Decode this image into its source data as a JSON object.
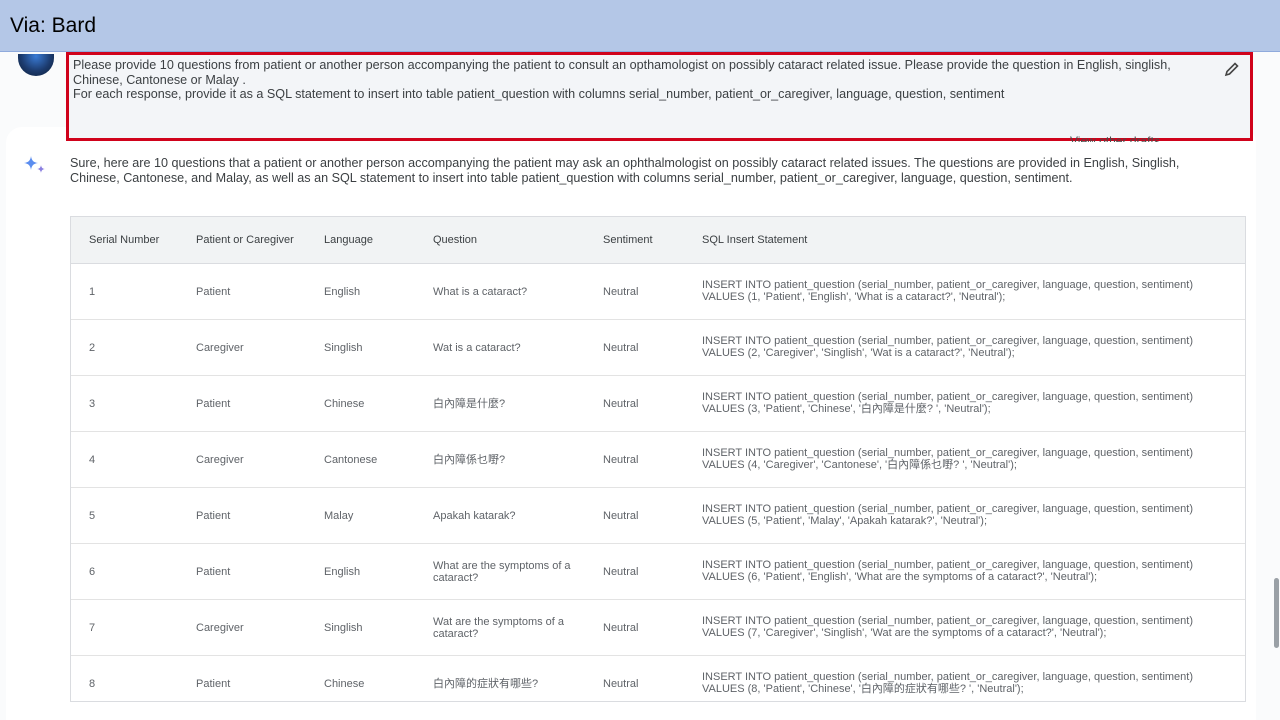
{
  "banner": {
    "text": "Via: Bard"
  },
  "prompt": {
    "text": "Please provide 10 questions from patient or another person accompanying the patient to consult an opthamologist on possibly cataract related issue. Please provide the question in English, singlish, Chinese, Cantonese or Malay .\nFor each response, provide it as a SQL statement to insert into table patient_question with columns serial_number, patient_or_caregiver, language, question, sentiment",
    "drafts_label": "View other drafts"
  },
  "response": {
    "text": "Sure, here are 10 questions that a patient or another person accompanying the patient may ask an ophthalmologist on possibly cataract related issues. The questions are provided in English, Singlish, Chinese, Cantonese, and Malay, as well as an SQL statement to insert into table patient_question with columns serial_number, patient_or_caregiver, language, question, sentiment."
  },
  "table": {
    "headers": [
      "Serial Number",
      "Patient or Caregiver",
      "Language",
      "Question",
      "Sentiment",
      "SQL Insert Statement"
    ],
    "rows": [
      [
        "1",
        "Patient",
        "English",
        "What is a cataract?",
        "Neutral",
        "INSERT INTO patient_question (serial_number, patient_or_caregiver, language, question, sentiment) VALUES (1, 'Patient', 'English', 'What is a cataract?', 'Neutral');"
      ],
      [
        "2",
        "Caregiver",
        "Singlish",
        "Wat is a cataract?",
        "Neutral",
        "INSERT INTO patient_question (serial_number, patient_or_caregiver, language, question, sentiment) VALUES (2, 'Caregiver', 'Singlish', 'Wat is a cataract?', 'Neutral');"
      ],
      [
        "3",
        "Patient",
        "Chinese",
        "白內障是什麼?",
        "Neutral",
        "INSERT INTO patient_question (serial_number, patient_or_caregiver, language, question, sentiment) VALUES (3, 'Patient', 'Chinese', '白內障是什麼? ', 'Neutral');"
      ],
      [
        "4",
        "Caregiver",
        "Cantonese",
        "白內障係乜嘢?",
        "Neutral",
        "INSERT INTO patient_question (serial_number, patient_or_caregiver, language, question, sentiment) VALUES (4, 'Caregiver', 'Cantonese', '白內障係乜嘢? ', 'Neutral');"
      ],
      [
        "5",
        "Patient",
        "Malay",
        "Apakah katarak?",
        "Neutral",
        "INSERT INTO patient_question (serial_number, patient_or_caregiver, language, question, sentiment) VALUES (5, 'Patient', 'Malay', 'Apakah katarak?', 'Neutral');"
      ],
      [
        "6",
        "Patient",
        "English",
        "What are the symptoms of a cataract?",
        "Neutral",
        "INSERT INTO patient_question (serial_number, patient_or_caregiver, language, question, sentiment) VALUES (6, 'Patient', 'English', 'What are the symptoms of a cataract?', 'Neutral');"
      ],
      [
        "7",
        "Caregiver",
        "Singlish",
        "Wat are the symptoms of a cataract?",
        "Neutral",
        "INSERT INTO patient_question (serial_number, patient_or_caregiver, language, question, sentiment) VALUES (7, 'Caregiver', 'Singlish', 'Wat are the symptoms of a cataract?', 'Neutral');"
      ],
      [
        "8",
        "Patient",
        "Chinese",
        "白內障的症狀有哪些?",
        "Neutral",
        "INSERT INTO patient_question (serial_number, patient_or_caregiver, language, question, sentiment) VALUES (8, 'Patient', 'Chinese', '白內障的症狀有哪些? ', 'Neutral');"
      ]
    ]
  },
  "icons": {
    "edit": "pencil-icon",
    "bard": "sparkle-icon"
  },
  "colors": {
    "banner": "#b4c7e7",
    "highlight": "#d0021b",
    "bard_blue": "#4285f4"
  }
}
